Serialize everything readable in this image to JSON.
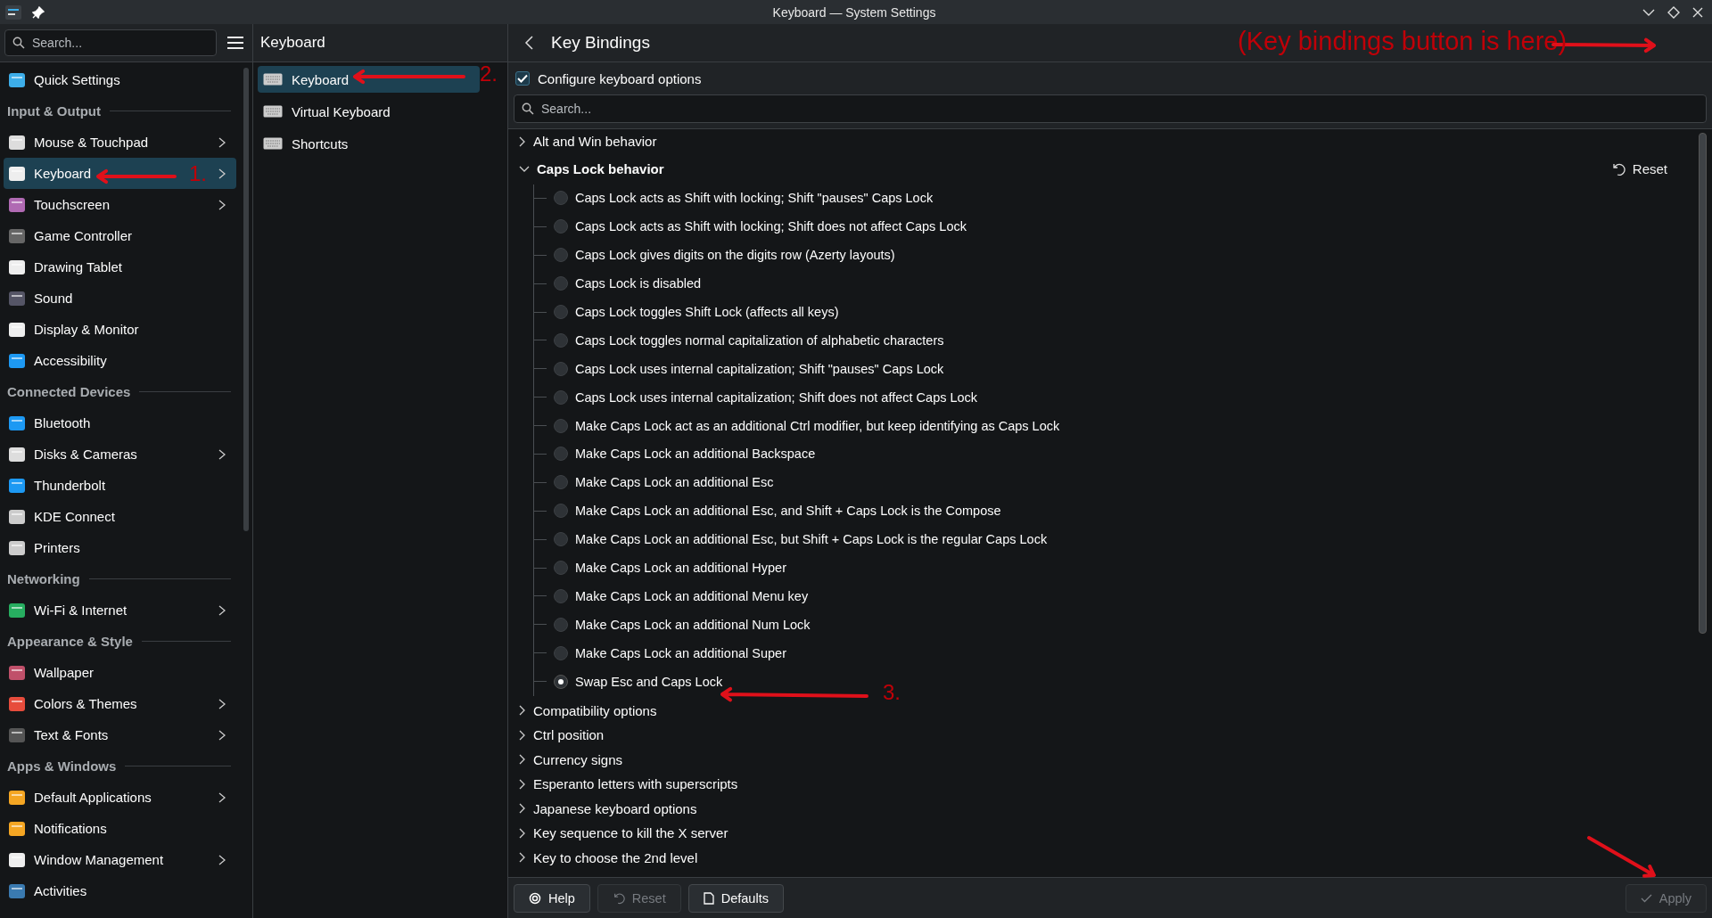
{
  "window": {
    "title": "Keyboard — System Settings"
  },
  "sidebar": {
    "search": {
      "placeholder": "Search..."
    },
    "items": [
      {
        "kind": "item",
        "label": "Quick Settings",
        "has_children": false,
        "selected": false
      },
      {
        "kind": "section",
        "label": "Input & Output"
      },
      {
        "kind": "item",
        "label": "Mouse & Touchpad",
        "has_children": true,
        "selected": false
      },
      {
        "kind": "item",
        "label": "Keyboard",
        "has_children": true,
        "selected": true
      },
      {
        "kind": "item",
        "label": "Touchscreen",
        "has_children": true,
        "selected": false
      },
      {
        "kind": "item",
        "label": "Game Controller",
        "has_children": false,
        "selected": false
      },
      {
        "kind": "item",
        "label": "Drawing Tablet",
        "has_children": false,
        "selected": false
      },
      {
        "kind": "item",
        "label": "Sound",
        "has_children": false,
        "selected": false
      },
      {
        "kind": "item",
        "label": "Display & Monitor",
        "has_children": false,
        "selected": false
      },
      {
        "kind": "item",
        "label": "Accessibility",
        "has_children": false,
        "selected": false
      },
      {
        "kind": "section",
        "label": "Connected Devices"
      },
      {
        "kind": "item",
        "label": "Bluetooth",
        "has_children": false,
        "selected": false
      },
      {
        "kind": "item",
        "label": "Disks & Cameras",
        "has_children": true,
        "selected": false
      },
      {
        "kind": "item",
        "label": "Thunderbolt",
        "has_children": false,
        "selected": false
      },
      {
        "kind": "item",
        "label": "KDE Connect",
        "has_children": false,
        "selected": false
      },
      {
        "kind": "item",
        "label": "Printers",
        "has_children": false,
        "selected": false
      },
      {
        "kind": "section",
        "label": "Networking"
      },
      {
        "kind": "item",
        "label": "Wi-Fi & Internet",
        "has_children": true,
        "selected": false
      },
      {
        "kind": "section",
        "label": "Appearance & Style"
      },
      {
        "kind": "item",
        "label": "Wallpaper",
        "has_children": false,
        "selected": false
      },
      {
        "kind": "item",
        "label": "Colors & Themes",
        "has_children": true,
        "selected": false
      },
      {
        "kind": "item",
        "label": "Text & Fonts",
        "has_children": true,
        "selected": false
      },
      {
        "kind": "section",
        "label": "Apps & Windows"
      },
      {
        "kind": "item",
        "label": "Default Applications",
        "has_children": true,
        "selected": false
      },
      {
        "kind": "item",
        "label": "Notifications",
        "has_children": false,
        "selected": false
      },
      {
        "kind": "item",
        "label": "Window Management",
        "has_children": true,
        "selected": false
      },
      {
        "kind": "item",
        "label": "Activities",
        "has_children": false,
        "selected": false
      }
    ]
  },
  "subpage": {
    "title": "Keyboard",
    "items": [
      {
        "label": "Keyboard",
        "selected": true
      },
      {
        "label": "Virtual Keyboard",
        "selected": false
      },
      {
        "label": "Shortcuts",
        "selected": false
      }
    ]
  },
  "content": {
    "title": "Key Bindings",
    "configure": {
      "label": "Configure keyboard options",
      "checked": true
    },
    "search": {
      "placeholder": "Search..."
    },
    "groups": [
      {
        "label": "Alt and Win behavior",
        "expanded": false
      },
      {
        "label": "Caps Lock behavior",
        "expanded": true,
        "reset": "Reset",
        "options": [
          {
            "label": "Caps Lock acts as Shift with locking; Shift \"pauses\" Caps Lock",
            "selected": false
          },
          {
            "label": "Caps Lock acts as Shift with locking; Shift does not affect Caps Lock",
            "selected": false
          },
          {
            "label": "Caps Lock gives digits on the digits row (Azerty layouts)",
            "selected": false
          },
          {
            "label": "Caps Lock is disabled",
            "selected": false
          },
          {
            "label": "Caps Lock toggles Shift Lock (affects all keys)",
            "selected": false
          },
          {
            "label": "Caps Lock toggles normal capitalization of alphabetic characters",
            "selected": false
          },
          {
            "label": "Caps Lock uses internal capitalization; Shift \"pauses\" Caps Lock",
            "selected": false
          },
          {
            "label": "Caps Lock uses internal capitalization; Shift does not affect Caps Lock",
            "selected": false
          },
          {
            "label": "Make Caps Lock act as an additional Ctrl modifier, but keep identifying as Caps Lock",
            "selected": false
          },
          {
            "label": "Make Caps Lock an additional Backspace",
            "selected": false
          },
          {
            "label": "Make Caps Lock an additional Esc",
            "selected": false
          },
          {
            "label": "Make Caps Lock an additional Esc, and Shift + Caps Lock is the Compose",
            "selected": false
          },
          {
            "label": "Make Caps Lock an additional Esc, but Shift + Caps Lock is the regular Caps Lock",
            "selected": false
          },
          {
            "label": "Make Caps Lock an additional Hyper",
            "selected": false
          },
          {
            "label": "Make Caps Lock an additional Menu key",
            "selected": false
          },
          {
            "label": "Make Caps Lock an additional Num Lock",
            "selected": false
          },
          {
            "label": "Make Caps Lock an additional Super",
            "selected": false
          },
          {
            "label": "Swap Esc and Caps Lock",
            "selected": true
          }
        ]
      },
      {
        "label": "Compatibility options",
        "expanded": false
      },
      {
        "label": "Ctrl position",
        "expanded": false
      },
      {
        "label": "Currency signs",
        "expanded": false
      },
      {
        "label": "Esperanto letters with superscripts",
        "expanded": false
      },
      {
        "label": "Japanese keyboard options",
        "expanded": false
      },
      {
        "label": "Key sequence to kill the X server",
        "expanded": false
      },
      {
        "label": "Key to choose the 2nd level",
        "expanded": false
      }
    ]
  },
  "footer": {
    "buttons": [
      {
        "kind": "help",
        "label": "Help",
        "disabled": false
      },
      {
        "kind": "reset",
        "label": "Reset",
        "disabled": true
      },
      {
        "kind": "defaults",
        "label": "Defaults",
        "disabled": false
      },
      {
        "kind": "apply",
        "label": "Apply",
        "disabled": true
      }
    ]
  },
  "annotations": [
    {
      "kind": "labeled",
      "text": "1."
    },
    {
      "kind": "labeled",
      "text": "2."
    },
    {
      "kind": "labeled",
      "text": "3."
    },
    {
      "kind": "labeled",
      "text": "(Key bindings button is here)"
    },
    {
      "kind": "arrow"
    }
  ]
}
